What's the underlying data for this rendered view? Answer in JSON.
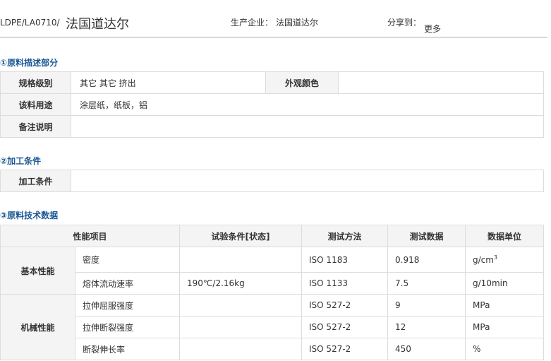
{
  "header": {
    "grade": "LDPE/LA0710/",
    "company": "法国道达尔",
    "producer_label": "生产企业：",
    "producer_value": "法国道达尔",
    "share_label": "分享到：",
    "share_more": "更多"
  },
  "section1": {
    "title": "①原料描述部分",
    "spec_label": "规格级别",
    "spec_value": "其它 其它 挤出",
    "color_label": "外观颜色",
    "color_value": "",
    "usage_label": "该料用途",
    "usage_value": "涂层纸，纸板，铝",
    "note_label": "备注说明",
    "note_value": ""
  },
  "section2": {
    "title": "②加工条件",
    "cond_label": "加工条件",
    "cond_value": ""
  },
  "section3": {
    "title": "③原料技术数据",
    "columns": [
      "性能项目",
      "试验条件[状态]",
      "测试方法",
      "测试数据",
      "数据单位"
    ],
    "groups": [
      {
        "name": "基本性能",
        "rows": [
          {
            "item": "密度",
            "condition": "",
            "method": "ISO 1183",
            "value": "0.918",
            "unit": "g/cm",
            "unit_sup": "3"
          },
          {
            "item": "熔体流动速率",
            "condition": "190℃/2.16kg",
            "method": "ISO 1133",
            "value": "7.5",
            "unit": "g/10min",
            "unit_sup": ""
          }
        ]
      },
      {
        "name": "机械性能",
        "rows": [
          {
            "item": "拉伸屈服强度",
            "condition": "",
            "method": "ISO 527-2",
            "value": "9",
            "unit": "MPa",
            "unit_sup": ""
          },
          {
            "item": "拉伸断裂强度",
            "condition": "",
            "method": "ISO 527-2",
            "value": "12",
            "unit": "MPa",
            "unit_sup": ""
          },
          {
            "item": "断裂伸长率",
            "condition": "",
            "method": "ISO 527-2",
            "value": "450",
            "unit": "%",
            "unit_sup": ""
          }
        ]
      }
    ]
  }
}
